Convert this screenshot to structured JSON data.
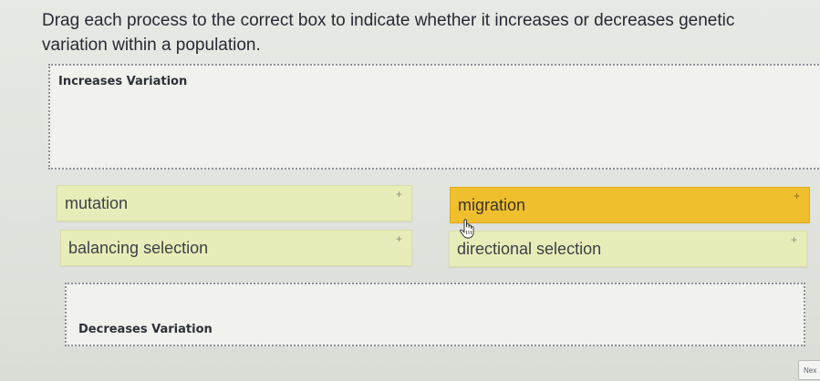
{
  "instruction": "Drag each process to the correct box to indicate whether it increases or decreases genetic variation within a population.",
  "zones": {
    "increases": {
      "label": "Increases Variation"
    },
    "decreases": {
      "label": "Decreases Variation"
    }
  },
  "cards": [
    {
      "label": "mutation",
      "handle": "+"
    },
    {
      "label": "migration",
      "handle": "+"
    },
    {
      "label": "balancing selection",
      "handle": "+"
    },
    {
      "label": "directional selection",
      "handle": "+"
    }
  ],
  "next_button": {
    "label": "Nex"
  },
  "colors": {
    "card": "#e8ecb8",
    "card_active": "#f0bf2e",
    "dropzone": "#f1f2ee"
  }
}
